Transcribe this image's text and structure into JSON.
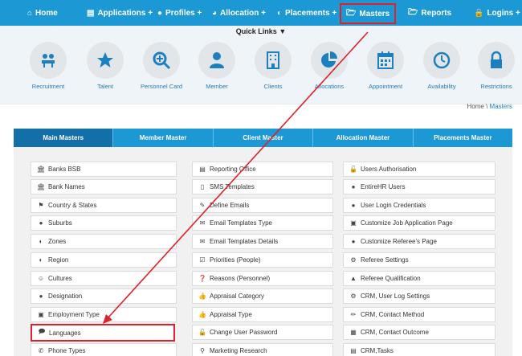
{
  "nav": {
    "home": "Home",
    "applications": "Applications +",
    "profiles": "Profiles +",
    "allocation": "Allocation +",
    "placements": "Placements +",
    "masters": "Masters",
    "reports": "Reports",
    "logins": "Logins +"
  },
  "quick_links": {
    "title": "Quick Links",
    "items": [
      {
        "label": "Recruitment"
      },
      {
        "label": "Talent"
      },
      {
        "label": "Personnel Card"
      },
      {
        "label": "Member"
      },
      {
        "label": "Clients"
      },
      {
        "label": "Allocations"
      },
      {
        "label": "Appointment"
      },
      {
        "label": "Availability"
      },
      {
        "label": "Restrictions"
      }
    ]
  },
  "breadcrumb": {
    "root": "Home",
    "separator": " \\ ",
    "current": "Masters"
  },
  "tabs": [
    "Main Masters",
    "Member Master",
    "Client Master",
    "Allocation Master",
    "Placements Master"
  ],
  "columns": {
    "col1": [
      "Banks BSB",
      "Bank Names",
      "Country & States",
      "Suburbs",
      "Zones",
      "Region",
      "Cultures",
      "Designation",
      "Employment Type",
      "Languages",
      "Phone Types"
    ],
    "col2": [
      "Reporting Office",
      "SMS Templates",
      "Define Emails",
      "Email Templates Type",
      "Email Templates Details",
      "Priorities (People)",
      "Reasons (Personnel)",
      "Appraisal Category",
      "Appraisal Type",
      "Change User Password",
      "Marketing Research"
    ],
    "col3": [
      "Users Authorisation",
      "EntireHR Users",
      "User Login Credentials",
      "Customize Job Application Page",
      "Customize Referee's Page",
      "Referee Settings",
      "Referee Qualification",
      "CRM, User Log Settings",
      "CRM, Contact Method",
      "CRM, Contact Outcome",
      "CRM,Tasks"
    ]
  },
  "colors": {
    "accent": "#1c98d4",
    "active_tab": "#136fa8",
    "highlight": "#e0202a"
  }
}
